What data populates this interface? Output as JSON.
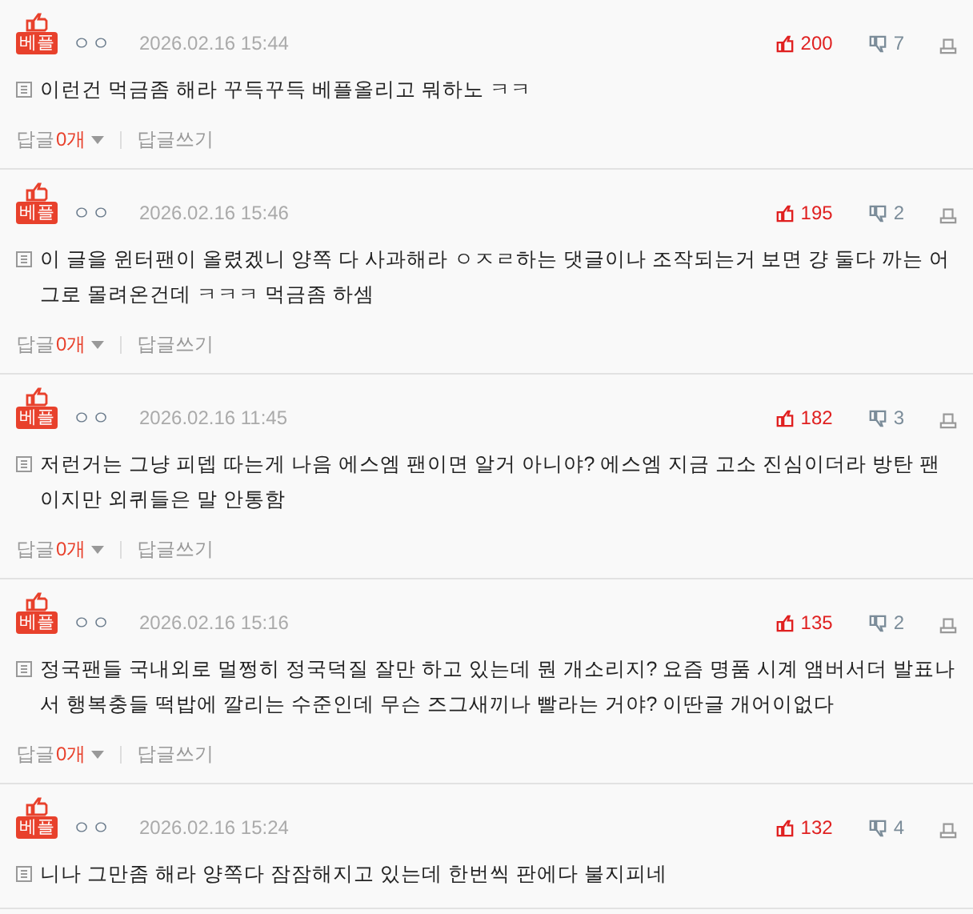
{
  "comments": [
    {
      "badge": "베플",
      "author": "ㅇㅇ",
      "date": "2026.02.16 15:44",
      "likes": "200",
      "dislikes": "7",
      "text": "이런건 먹금좀 해라 꾸득꾸득 베플올리고 뭐하노 ㅋㅋ",
      "replies_label": "답글",
      "reply_count": "0개",
      "write_reply": "답글쓰기"
    },
    {
      "badge": "베플",
      "author": "ㅇㅇ",
      "date": "2026.02.16 15:46",
      "likes": "195",
      "dislikes": "2",
      "text": "이 글을 윈터팬이 올렸겠니 양쪽 다 사과해라 ㅇㅈㄹ하는 댓글이나 조작되는거 보면 걍 둘다 까는 어그로 몰려온건데 ㅋㅋㅋ 먹금좀 하셈",
      "replies_label": "답글",
      "reply_count": "0개",
      "write_reply": "답글쓰기"
    },
    {
      "badge": "베플",
      "author": "ㅇㅇ",
      "date": "2026.02.16 11:45",
      "likes": "182",
      "dislikes": "3",
      "text": "저런거는 그냥 피뎁 따는게 나음 에스엠 팬이면 알거 아니야? 에스엠 지금 고소 진심이더라 방탄 팬이지만 외퀴들은 말 안통함",
      "replies_label": "답글",
      "reply_count": "0개",
      "write_reply": "답글쓰기"
    },
    {
      "badge": "베플",
      "author": "ㅇㅇ",
      "date": "2026.02.16 15:16",
      "likes": "135",
      "dislikes": "2",
      "text": "정국팬들 국내외로 멀쩡히 정국덕질 잘만 하고 있는데 뭔 개소리지? 요즘 명품 시계 앰버서더 발표나서 행복충들 떡밥에 깔리는 수준인데 무슨 즈그새끼나 빨라는 거야? 이딴글 개어이없다",
      "replies_label": "답글",
      "reply_count": "0개",
      "write_reply": "답글쓰기"
    },
    {
      "badge": "베플",
      "author": "ㅇㅇ",
      "date": "2026.02.16 15:24",
      "likes": "132",
      "dislikes": "4",
      "text": "니나 그만좀 해라 양쪽다 잠잠해지고 있는데 한번씩 판에다 불지피네"
    }
  ]
}
